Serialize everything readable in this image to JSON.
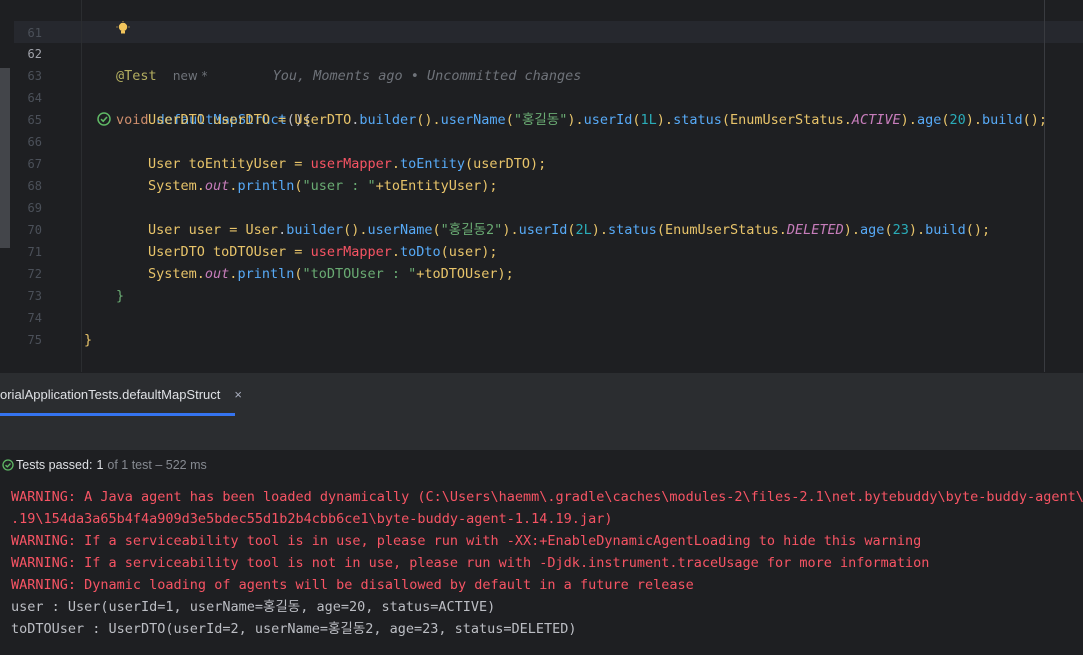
{
  "editor": {
    "lines": [
      {
        "number": "61"
      },
      {
        "number": "62",
        "annotation": "@Test",
        "inlay": "new *",
        "blame": "You, Moments ago • Uncommitted changes"
      },
      {
        "number": "63",
        "kw": "void",
        "method": "defaultMapStruct",
        "rest": "(){"
      },
      {
        "number": "64"
      },
      {
        "number": "65"
      },
      {
        "number": "66"
      },
      {
        "number": "67"
      },
      {
        "number": "68"
      },
      {
        "number": "69"
      },
      {
        "number": "70"
      },
      {
        "number": "71"
      },
      {
        "number": "72",
        "text": "}"
      },
      {
        "number": "73"
      },
      {
        "number": "74",
        "text": "}"
      },
      {
        "number": "75"
      }
    ],
    "l64": {
      "t1": "UserDTO userDTO = ",
      "t2": "UserDTO",
      "t3": ".",
      "m1": "builder",
      "t4": "().",
      "m2": "userName",
      "t5": "(",
      "s1": "\"홍길동\"",
      "t6": ").",
      "m3": "userId",
      "t7": "(",
      "n1": "1L",
      "t8": ").",
      "m4": "status",
      "t9": "(EnumUserStatus.",
      "e1": "ACTIVE",
      "t10": ").",
      "m5": "age",
      "t11": "(",
      "n2": "20",
      "t12": ").",
      "m6": "build",
      "t13": "();"
    },
    "l66": {
      "t1": "User toEntityUser = ",
      "v1": "userMapper",
      "t2": ".",
      "m1": "toEntity",
      "t3": "(userDTO);"
    },
    "l67": {
      "t1": "System.",
      "f1": "out",
      "t2": ".",
      "m1": "println",
      "t3": "(",
      "s1": "\"user : \"",
      "t4": "+toEntityUser);"
    },
    "l69": {
      "t1": "User user = ",
      "t2": "User",
      "t3": ".",
      "m1": "builder",
      "t4": "().",
      "m2": "userName",
      "t5": "(",
      "s1": "\"홍길동2\"",
      "t6": ").",
      "m3": "userId",
      "t7": "(",
      "n1": "2L",
      "t8": ").",
      "m4": "status",
      "t9": "(EnumUserStatus.",
      "e1": "DELETED",
      "t10": ").",
      "m5": "age",
      "t11": "(",
      "n2": "23",
      "t12": ").",
      "m6": "build",
      "t13": "();"
    },
    "l70": {
      "t1": "UserDTO toDTOUser = ",
      "v1": "userMapper",
      "t2": ".",
      "m1": "toDto",
      "t3": "(user);"
    },
    "l71": {
      "t1": "System.",
      "f1": "out",
      "t2": ".",
      "m1": "println",
      "t3": "(",
      "s1": "\"toDTOUser : \"",
      "t4": "+toDTOUser);"
    }
  },
  "run_panel": {
    "tab_label": "orialApplicationTests.defaultMapStruct",
    "tab_close": "×"
  },
  "status": {
    "passed_label": "Tests passed:",
    "passed_count": "1",
    "of_total": "of 1 test – 522 ms"
  },
  "console": [
    {
      "kind": "warn",
      "text": "WARNING: A Java agent has been loaded dynamically (C:\\Users\\haemm\\.gradle\\caches\\modules-2\\files-2.1\\net.bytebuddy\\byte-buddy-agent\\1."
    },
    {
      "kind": "warn",
      "text": ".19\\154da3a65b4f4a909d3e5bdec55d1b2b4cbb6ce1\\byte-buddy-agent-1.14.19.jar)"
    },
    {
      "kind": "warn",
      "text": "WARNING: If a serviceability tool is in use, please run with -XX:+EnableDynamicAgentLoading to hide this warning"
    },
    {
      "kind": "warn",
      "text": "WARNING: If a serviceability tool is not in use, please run with -Djdk.instrument.traceUsage for more information"
    },
    {
      "kind": "warn",
      "text": "WARNING: Dynamic loading of agents will be disallowed by default in a future release"
    },
    {
      "kind": "out",
      "text": "user : User(userId=1, userName=홍길동, age=20, status=ACTIVE)"
    },
    {
      "kind": "out",
      "text": "toDTOUser : UserDTO(userId=2, userName=홍길동2, age=23, status=DELETED)"
    }
  ],
  "colors": {
    "background": "#1e1f22",
    "panel": "#2b2d30",
    "warning": "#f75464",
    "success": "#5fb865",
    "accent": "#3574f0"
  },
  "icons": [
    "lightbulb-icon",
    "test-passed-gutter-icon",
    "tab-close-icon",
    "tests-passed-icon"
  ]
}
